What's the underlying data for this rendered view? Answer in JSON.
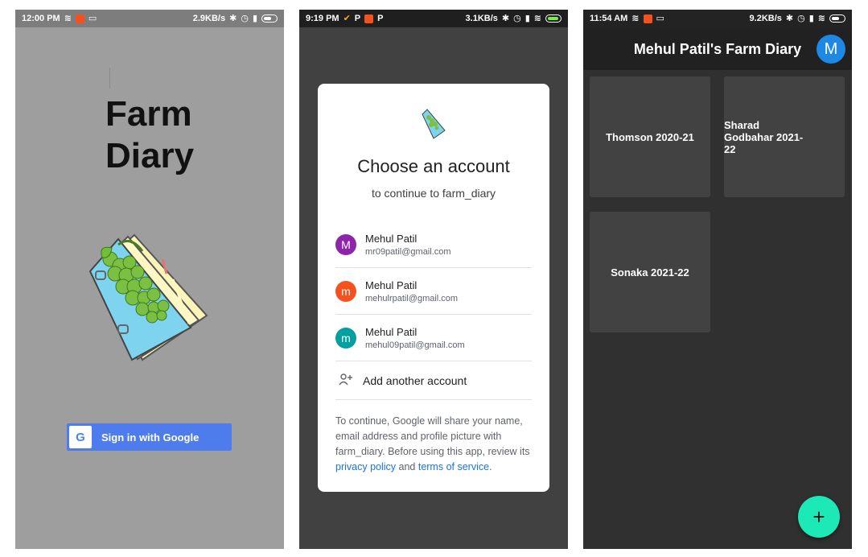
{
  "screen1": {
    "status": {
      "time": "12:00 PM",
      "speed": "2.9KB/s"
    },
    "title_line1": "Farm",
    "title_line2": "Diary",
    "signin_label": "Sign in with Google",
    "google_letter": "G"
  },
  "screen2": {
    "status": {
      "time": "9:19 PM",
      "speed": "3.1KB/s"
    },
    "dialog": {
      "title": "Choose an account",
      "subtitle": "to continue to farm_diary",
      "accounts": [
        {
          "initial": "M",
          "name": "Mehul Patil",
          "email": "mr09patil@gmail.com",
          "color": "#8e24aa"
        },
        {
          "initial": "m",
          "name": "Mehul Patil",
          "email": "mehulrpatil@gmail.com",
          "color": "#f4511e"
        },
        {
          "initial": "m",
          "name": "Mehul Patil",
          "email": "mehul09patil@gmail.com",
          "color": "#00a0a0"
        }
      ],
      "add_account_label": "Add another account",
      "note_prefix": "To continue, Google will share your name, email address and profile picture with farm_diary. Before using this app, review its ",
      "privacy_link": "privacy policy",
      "note_and": " and ",
      "terms_link": "terms of service",
      "note_suffix": "."
    }
  },
  "screen3": {
    "status": {
      "time": "11:54 AM",
      "speed": "9.2KB/s"
    },
    "appbar_title": "Mehul Patil's Farm Diary",
    "avatar_initial": "M",
    "cards": [
      {
        "label": "Thomson 2020-21"
      },
      {
        "label": "Sharad Godbahar 2021-22"
      },
      {
        "label": "Sonaka 2021-22"
      }
    ],
    "fab_label": "+"
  },
  "colors": {
    "google_blue": "#4f7cec",
    "fab_teal": "#1de9b6",
    "appbar_avatar": "#1e88e5",
    "link_blue": "#1a73e8"
  },
  "icons": [
    "wifi-icon",
    "bluetooth-icon",
    "alarm-icon",
    "signal-icon",
    "battery-icon",
    "laptop-icon",
    "add-person-icon",
    "farm-diary-logo-icon",
    "google-g-icon",
    "plus-icon"
  ]
}
